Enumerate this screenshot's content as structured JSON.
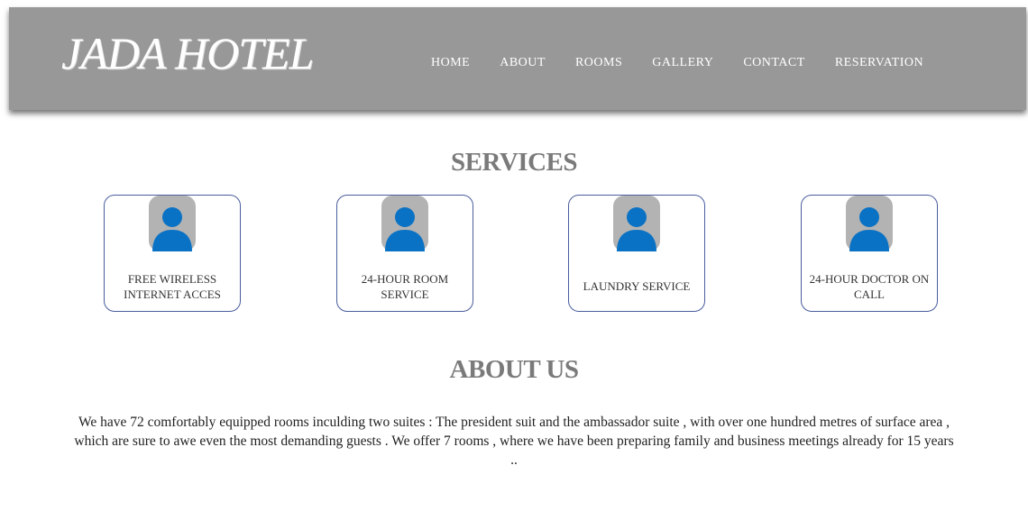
{
  "brand": {
    "logo_text": "JADA HOTEL",
    "header_color": "#989898",
    "accent": "#0a72c4"
  },
  "nav": [
    {
      "label": "HOME"
    },
    {
      "label": "ABOUT"
    },
    {
      "label": "ROOMS"
    },
    {
      "label": "GALLERY"
    },
    {
      "label": "CONTACT"
    },
    {
      "label": "RESERVATION"
    }
  ],
  "services": {
    "title": "SERVICES",
    "items": [
      {
        "label": "FREE WIRELESS INTERNET ACCES",
        "icon": "user-avatar-icon"
      },
      {
        "label": "24-HOUR ROOM SERVICE",
        "icon": "user-avatar-icon"
      },
      {
        "label": "LAUNDRY SERVICE",
        "icon": "user-avatar-icon"
      },
      {
        "label": "24-HOUR DOCTOR ON CALL",
        "icon": "user-avatar-icon"
      }
    ]
  },
  "about": {
    "title": "ABOUT US",
    "text": "We have 72 comfortably equipped rooms inculding two suites : The president suit and the ambassador suite , with over one hundred metres of surface area , which are sure to awe even the most demanding guests . We offer 7 rooms , where we have been preparing family and business meetings already for 15 years .."
  }
}
